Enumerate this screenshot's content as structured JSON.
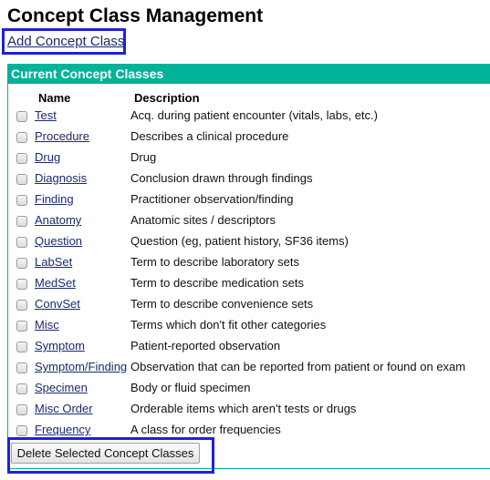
{
  "page": {
    "title": "Concept Class Management",
    "add_link": "Add Concept Class"
  },
  "box": {
    "header": "Current Concept Classes",
    "columns": {
      "name": "Name",
      "description": "Description"
    },
    "rows": [
      {
        "name": "Test",
        "description": "Acq. during patient encounter (vitals, labs, etc.)",
        "checked": false
      },
      {
        "name": "Procedure",
        "description": "Describes a clinical procedure",
        "checked": false
      },
      {
        "name": "Drug",
        "description": "Drug",
        "checked": false
      },
      {
        "name": "Diagnosis",
        "description": "Conclusion drawn through findings",
        "checked": false
      },
      {
        "name": "Finding",
        "description": "Practitioner observation/finding",
        "checked": false
      },
      {
        "name": "Anatomy",
        "description": "Anatomic sites / descriptors",
        "checked": false
      },
      {
        "name": "Question",
        "description": "Question (eg, patient history, SF36 items)",
        "checked": false
      },
      {
        "name": "LabSet",
        "description": "Term to describe laboratory sets",
        "checked": false
      },
      {
        "name": "MedSet",
        "description": "Term to describe medication sets",
        "checked": false
      },
      {
        "name": "ConvSet",
        "description": "Term to describe convenience sets",
        "checked": false
      },
      {
        "name": "Misc",
        "description": "Terms which don't fit other categories",
        "checked": false
      },
      {
        "name": "Symptom",
        "description": "Patient-reported observation",
        "checked": false
      },
      {
        "name": "Symptom/Finding",
        "description": "Observation that can be reported from patient or found on exam",
        "checked": false
      },
      {
        "name": "Specimen",
        "description": "Body or fluid specimen",
        "checked": false
      },
      {
        "name": "Misc Order",
        "description": "Orderable items which aren't tests or drugs",
        "checked": false
      },
      {
        "name": "Frequency",
        "description": "A class for order frequencies",
        "checked": false
      }
    ],
    "delete_button": "Delete Selected Concept Classes"
  },
  "colors": {
    "accent": "#00b398",
    "link": "#1a2a6b",
    "highlight": "#1f1fe0"
  }
}
